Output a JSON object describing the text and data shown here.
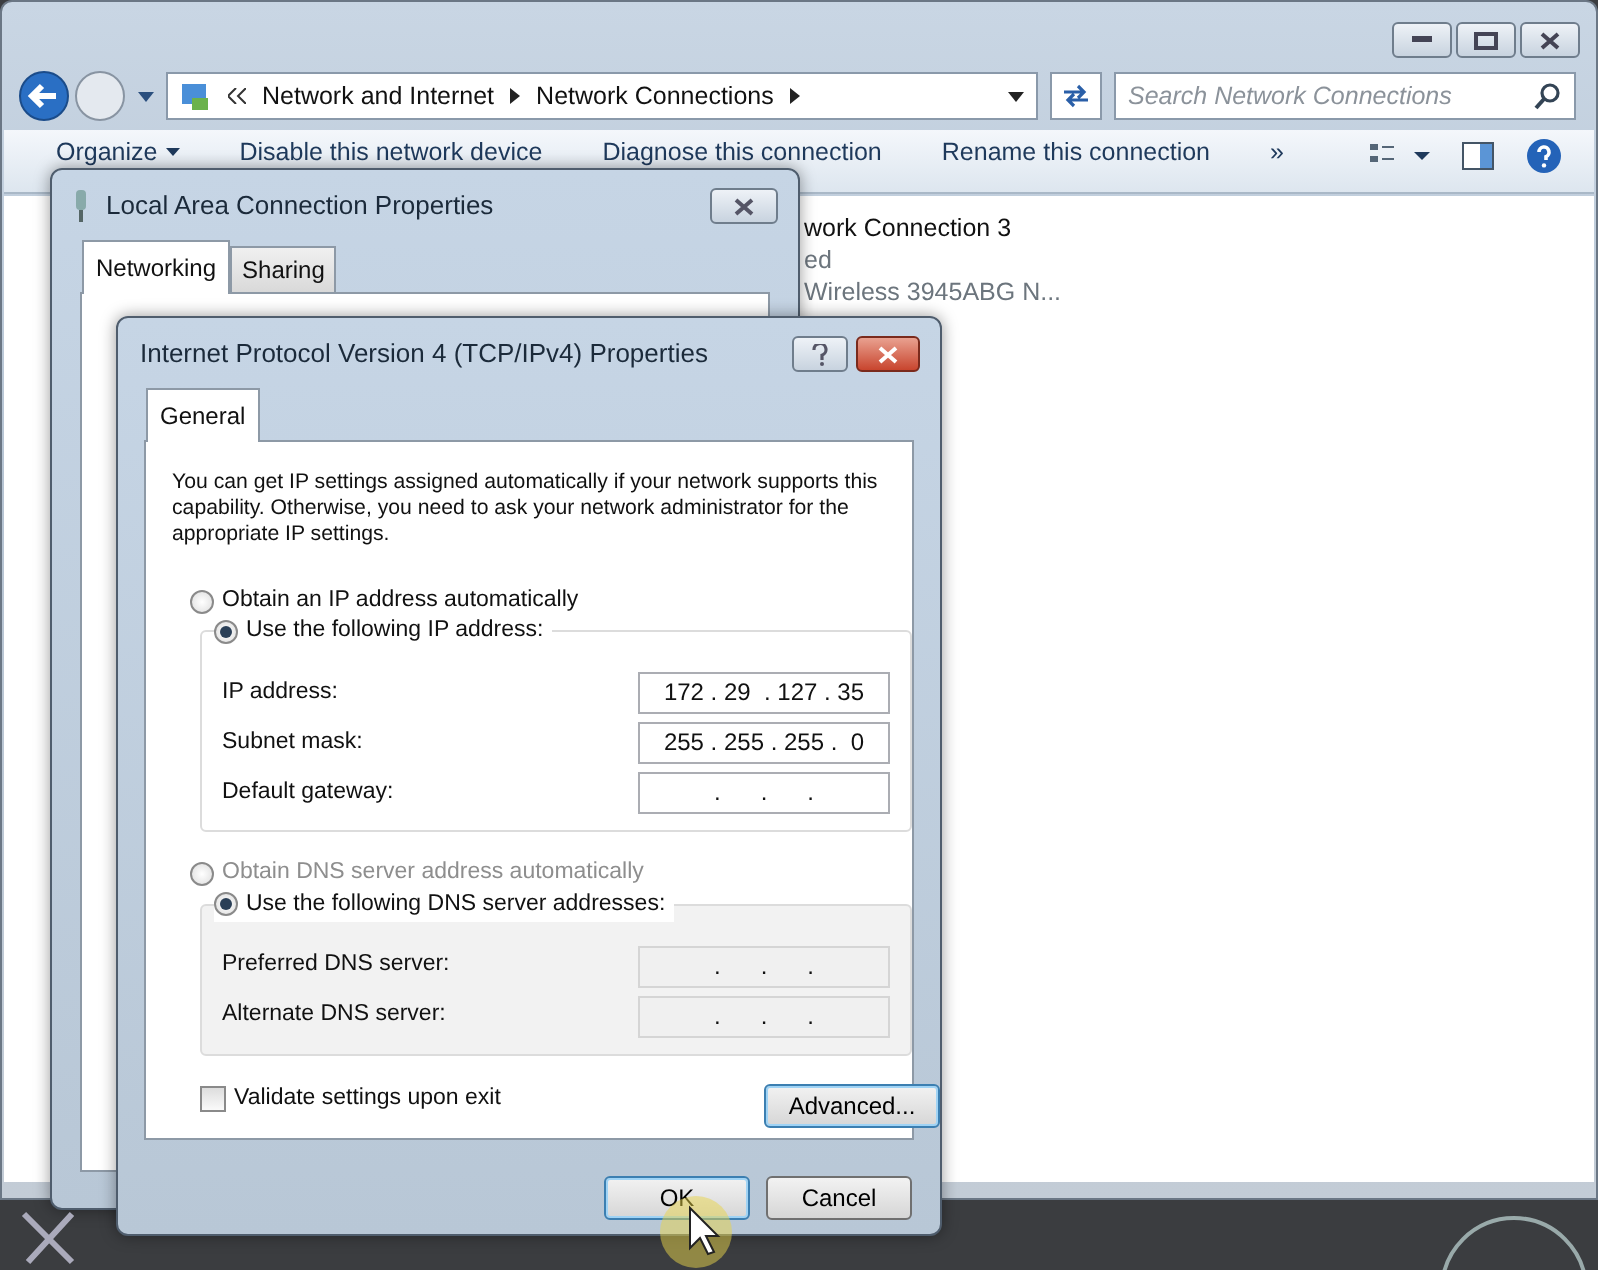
{
  "explorer": {
    "breadcrumb": [
      {
        "label": "Network and Internet"
      },
      {
        "label": "Network Connections"
      }
    ],
    "search": {
      "placeholder": "Search Network Connections"
    },
    "toolbar": [
      {
        "kind": "menu",
        "label": "Organize"
      },
      {
        "kind": "command",
        "label": "Disable this network device"
      },
      {
        "kind": "command",
        "label": "Diagnose this connection"
      },
      {
        "kind": "command",
        "label": "Rename this connection"
      },
      {
        "kind": "command",
        "label": "»"
      }
    ],
    "connection": {
      "name": "work Connection 3",
      "status": "ed",
      "adapter": "Wireless 3945ABG N..."
    }
  },
  "lan_dialog": {
    "title": "Local Area Connection Properties",
    "tabs": [
      {
        "label": "Networking",
        "selected": true
      },
      {
        "label": "Sharing",
        "selected": false
      }
    ]
  },
  "ipv4_dialog": {
    "title": "Internet Protocol Version 4 (TCP/IPv4) Properties",
    "tabs": [
      {
        "label": "General",
        "selected": true
      }
    ],
    "description": "You can get IP settings assigned automatically if your network supports this capability. Otherwise, you need to ask your network administrator for the appropriate IP settings.",
    "ip_options": [
      {
        "label": "Obtain an IP address automatically",
        "selected": false,
        "disabled": false
      },
      {
        "label": "Use the following IP address:",
        "selected": true,
        "disabled": false
      }
    ],
    "ip_fields": [
      {
        "label": "IP address:",
        "value": "172 . 29  . 127 . 35",
        "disabled": false
      },
      {
        "label": "Subnet mask:",
        "value": "255 . 255 . 255 .  0",
        "disabled": false
      },
      {
        "label": "Default gateway:",
        "value": ".      .      .",
        "disabled": false
      }
    ],
    "dns_options": [
      {
        "label": "Obtain DNS server address automatically",
        "selected": false,
        "disabled": true
      },
      {
        "label": "Use the following DNS server addresses:",
        "selected": true,
        "disabled": false
      }
    ],
    "dns_fields": [
      {
        "label": "Preferred DNS server:",
        "value": ".      .      .",
        "disabled": true
      },
      {
        "label": "Alternate DNS server:",
        "value": ".      .      .",
        "disabled": true
      }
    ],
    "validate": {
      "label": "Validate settings upon exit",
      "checked": false
    },
    "advanced_button": "Advanced...",
    "buttons": [
      {
        "label": "OK",
        "focused": true
      },
      {
        "label": "Cancel",
        "focused": false
      }
    ]
  }
}
